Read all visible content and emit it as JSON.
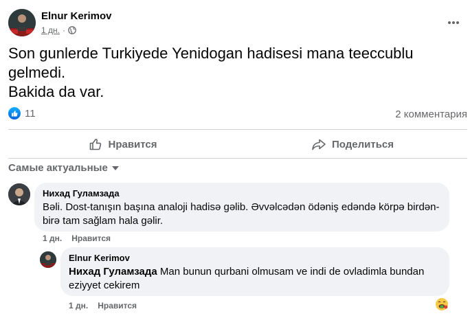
{
  "post": {
    "author": "Elnur Kerimov",
    "time": "1 дн.",
    "separator": "·",
    "text_lines": [
      "Son gunlerde Turkiyede Yenidogan hadisesi mana teeccublu",
      "gelmedi.",
      "Bakida da var."
    ],
    "likes_count": "11",
    "comments_count": "2 комментария"
  },
  "actions": {
    "like_label": "Нравится",
    "share_label": "Поделиться"
  },
  "comments_sort": "Самые актуальные",
  "comments": [
    {
      "author": "Нихад Гуламзада",
      "text_lines": [
        "Bəli. Dost-tanışın başına analoji hadisə gəlib. Əvvəlcədən ödəniş edəndə körpə birdən-",
        "birə tam sağlam hala gəlir."
      ],
      "time": "1 дн.",
      "like_label": "Нравится"
    }
  ],
  "reply": {
    "author": "Elnur Kerimov",
    "mention": "Нихад Гуламзада",
    "text_line1": "Man bunun qurbani olmusam ve indi de ovladimla bundan",
    "text_line2": "eziyyet cekirem",
    "time": "1 дн.",
    "like_label": "Нравится",
    "reaction_icon": "money-mouth-face"
  },
  "colors": {
    "accent": "#1877f2",
    "muted": "#65676b",
    "bubble": "#f0f2f5"
  }
}
